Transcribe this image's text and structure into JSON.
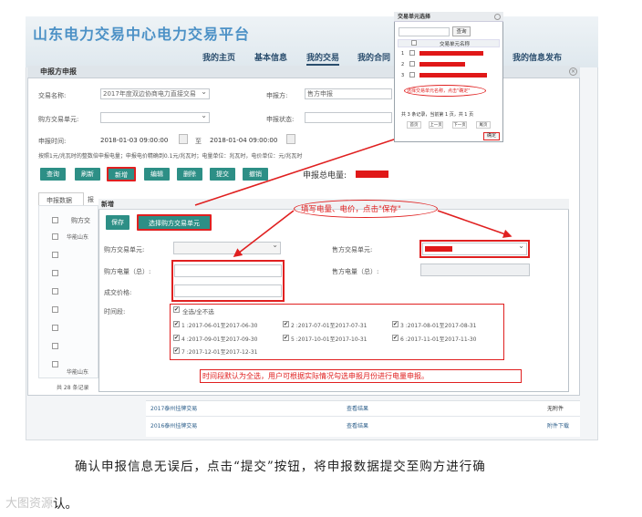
{
  "header": {
    "logo": "山东电力交易中心电力交易平台",
    "nav": [
      "我的主页",
      "基本信息",
      "我的交易",
      "我的合同",
      "我的信息发布"
    ],
    "active_nav": "我的交易"
  },
  "panel": {
    "title": "申报方申报",
    "fields": {
      "trade_name_label": "交易名称:",
      "trade_name_value": "2017年度双边协商电力直接交易",
      "buyer_unit_label": "购方交易单元:",
      "declare_time_label": "申报时间:",
      "time_start": "2018-01-03 09:00:00",
      "time_sep": "至",
      "time_end": "2018-01-04 09:00:00",
      "declarer_label": "申报方:",
      "declarer_value": "售方申报",
      "status_label": "申报状态:"
    },
    "note": "按照1元/兆瓦时的整数倍申报电量；申报电价精确到0.1元/兆瓦时；电量单位：兆瓦时，电价单位：元/兆瓦时",
    "buttons": [
      "查询",
      "刷新",
      "新增",
      "编辑",
      "删除",
      "提交",
      "撤销"
    ],
    "total_label": "申报总电量:",
    "tabs": [
      "申报数据",
      "报"
    ],
    "grid_header": "购方交",
    "grid_rows": [
      "华能山东",
      "华能山东"
    ],
    "pager": "共 28 条记录"
  },
  "dialog": {
    "title": "新增",
    "save": "保存",
    "select_buyer": "选择购方交易单元",
    "buyer_unit_label": "购方交易单元:",
    "seller_unit_label": "售方交易单元:",
    "buyer_qty_label": "购方电量（总）:",
    "seller_qty_label": "售方电量（总）:",
    "price_label": "成交价格:",
    "period_label": "时间段:",
    "select_all": "全选/全不选",
    "periods": [
      "1 :2017-06-01至2017-06-30",
      "2 :2017-07-01至2017-07-31",
      "3 :2017-08-01至2017-08-31",
      "4 :2017-09-01至2017-09-30",
      "5 :2017-10-01至2017-10-31",
      "6 :2017-11-01至2017-11-30",
      "7 :2017-12-01至2017-12-31"
    ]
  },
  "annotations": {
    "fill_note": "填写电量、电价，点击\"保存\"",
    "period_note": "时间段默认为全选，用户可根据实际情况勾选申报月份进行电量申报。",
    "popup_note": "选择交易单元名称，点击\"确定\""
  },
  "popup": {
    "title": "交易单元选择",
    "search_btn": "查询",
    "col_header": "交易单元名称",
    "rows": [
      "1",
      "2",
      "3"
    ],
    "pager": "共 3 条记录，当前第 1 页，共 1 页",
    "pager_btns": [
      "首页",
      "上一页",
      "下一页",
      "尾页"
    ],
    "confirm": "确定"
  },
  "bottom_rows": [
    {
      "name": "2017泰州挂牌交易",
      "action": "查看结果",
      "extra": "无附件"
    },
    {
      "name": "2016泰州挂牌交易",
      "action": "查看结果",
      "extra": "附件下载"
    }
  ],
  "caption_line1": "确认申报信息无误后，点击“提交”按钮，将申报数据提交至购方进行确",
  "caption_line2": "认。",
  "watermark": "大图资源"
}
